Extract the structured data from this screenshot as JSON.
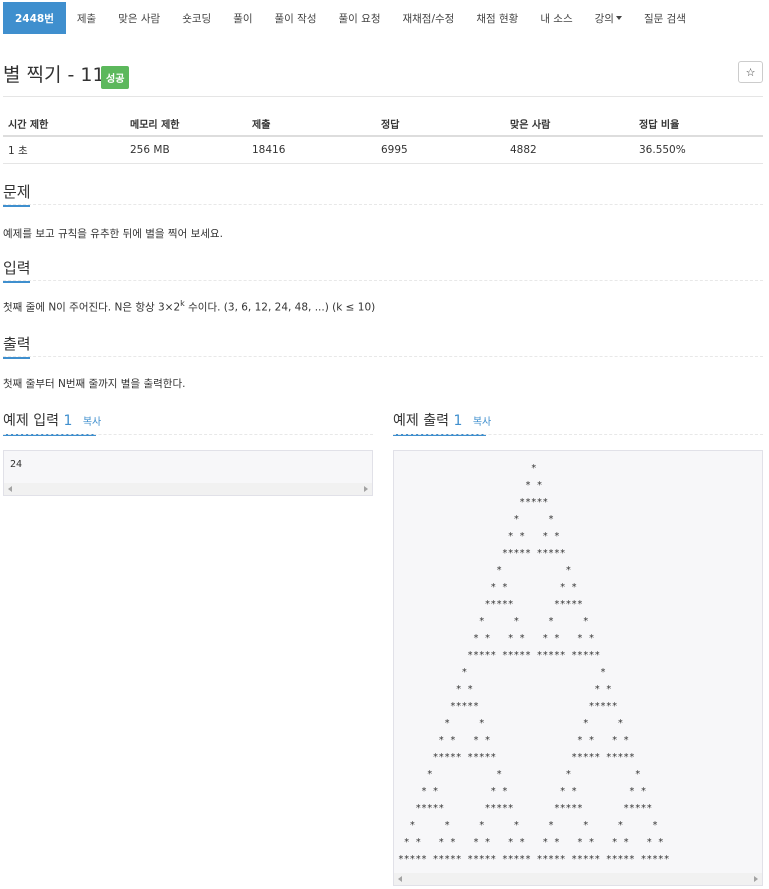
{
  "nav": {
    "items": [
      "2448번",
      "제출",
      "맞은 사람",
      "숏코딩",
      "풀이",
      "풀이 작성",
      "풀이 요청",
      "재채점/수정",
      "채점 현황",
      "내 소스",
      "강의",
      "질문 검색"
    ]
  },
  "problem": {
    "title": "별 찍기 - 11",
    "badge": "성공",
    "star_icon": "star-outline-icon"
  },
  "info": {
    "headers": [
      "시간 제한",
      "메모리 제한",
      "제출",
      "정답",
      "맞은 사람",
      "정답 비율"
    ],
    "values": [
      "1 초",
      "256 MB",
      "18416",
      "6995",
      "4882",
      "36.550%"
    ]
  },
  "sections": {
    "problem_heading": "문제",
    "problem_text": "예제를 보고 규칙을 유추한 뒤에 별을 찍어 보세요.",
    "input_heading": "입력",
    "input_text_pre": "첫째 줄에 N이 주어진다. N은 항상 3×2",
    "input_text_sup": "k",
    "input_text_post": " 수이다. (3, 6, 12, 24, 48, ...) (k ≤ 10)",
    "output_heading": "출력",
    "output_text": "첫째 줄부터 N번째 줄까지 별을 출력한다."
  },
  "samples": {
    "input_label": "예제 입력",
    "input_num": "1",
    "output_label": "예제 출력",
    "output_num": "1",
    "copy": "복사",
    "input_text": "24",
    "output_text": "                       *                       \n                      * *                      \n                     *****                     \n                    *     *                    \n                   * *   * *                   \n                  ***** *****                  \n                 *           *                 \n                * *         * *                \n               *****       *****               \n              *     *     *     *              \n             * *   * *   * *   * *             \n            ***** ***** ***** *****            \n           *                       *           \n          * *                     * *          \n         *****                   *****         \n        *     *                 *     *        \n       * *   * *               * *   * *       \n      ***** *****             ***** *****      \n     *           *           *           *     \n    * *         * *         * *         * *    \n   *****       *****       *****       *****   \n  *     *     *     *     *     *     *     *  \n * *   * *   * *   * *   * *   * *   * *   * * \n***** ***** ***** ***** ***** ***** ***** *****"
  },
  "colors": {
    "accent": "#3f8fce",
    "success": "#5cb85c"
  }
}
